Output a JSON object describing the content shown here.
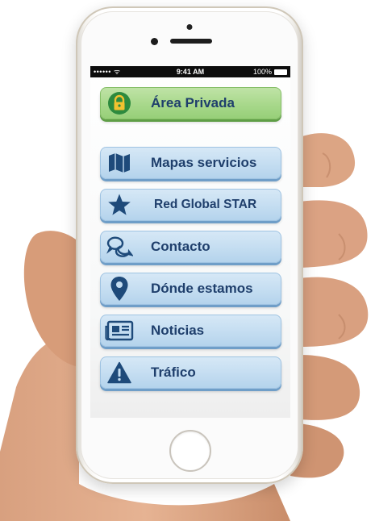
{
  "status_bar": {
    "signal": "•••••• ᯤ",
    "time": "9:41 AM",
    "battery": "100%"
  },
  "menu": {
    "items": [
      {
        "label": "Área Privada",
        "icon": "padlock-icon",
        "style": "green"
      },
      {
        "label": "Mapas servicios",
        "icon": "map-icon",
        "style": "blue"
      },
      {
        "label": "Red Global STAR",
        "icon": "star-icon",
        "style": "blue"
      },
      {
        "label": "Contacto",
        "icon": "chat-bubbles-icon",
        "style": "blue"
      },
      {
        "label": "Dónde estamos",
        "icon": "location-pin-icon",
        "style": "blue"
      },
      {
        "label": "Noticias",
        "icon": "newspaper-icon",
        "style": "blue"
      },
      {
        "label": "Tráfico",
        "icon": "warning-icon",
        "style": "blue"
      }
    ]
  },
  "colors": {
    "button_blue": "#c4ddf1",
    "button_green": "#a8d88b",
    "text_navy": "#1f3f6c",
    "icon_navy": "#1e4a7a"
  }
}
